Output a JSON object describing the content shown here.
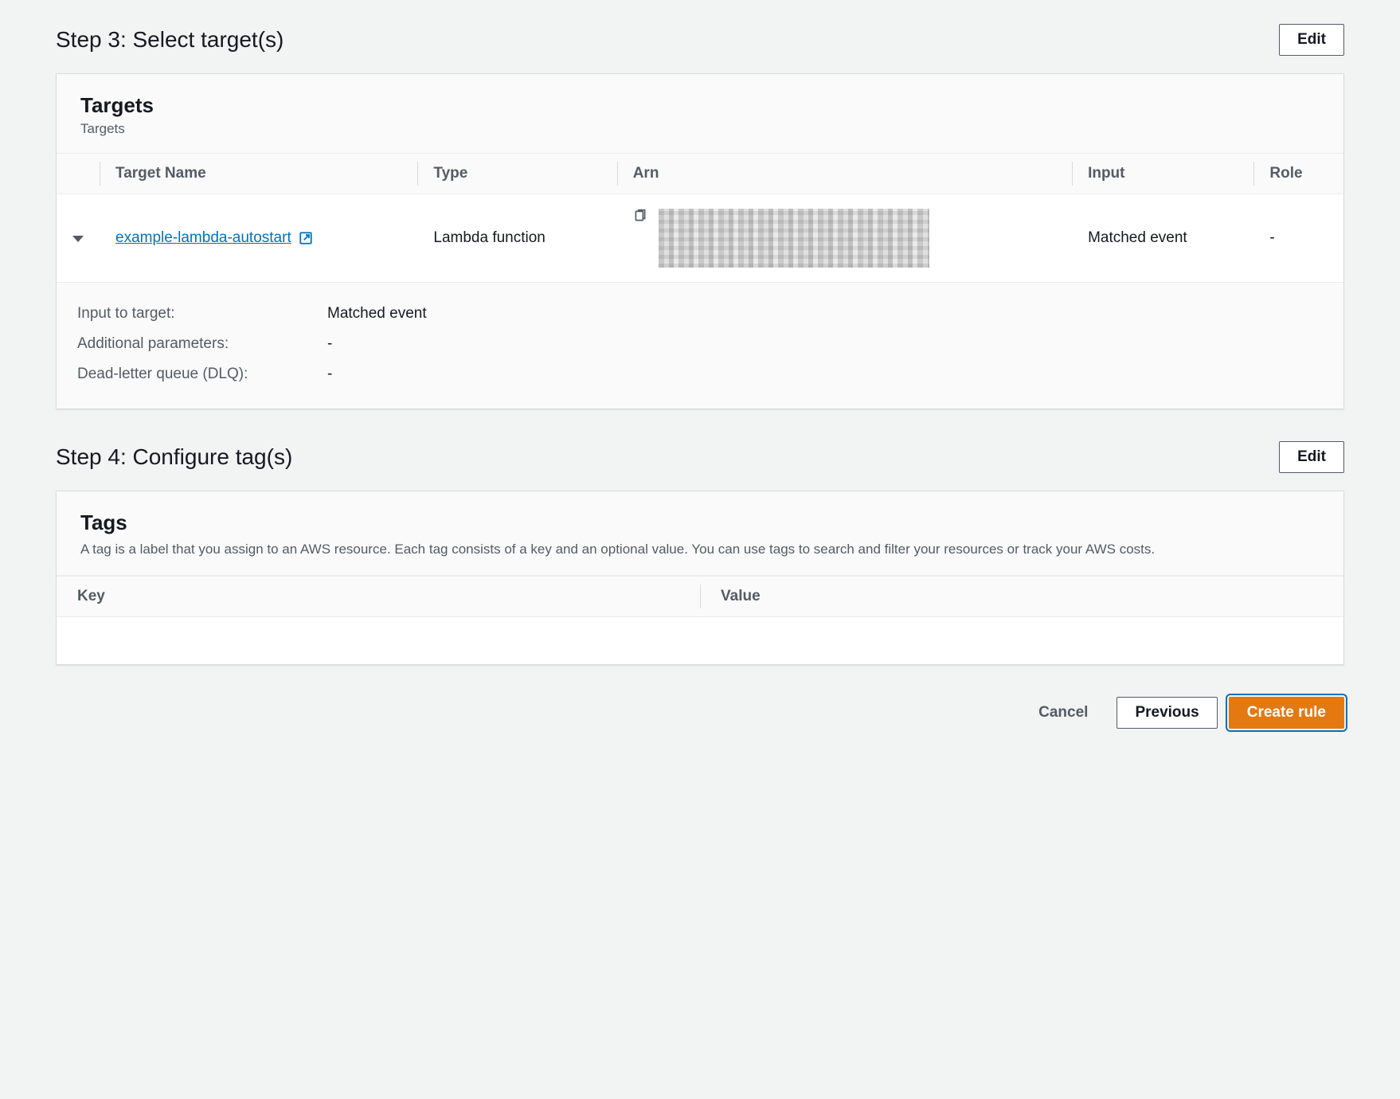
{
  "step3": {
    "title": "Step 3: Select target(s)",
    "edit_label": "Edit",
    "panel_title": "Targets",
    "panel_sub": "Targets",
    "columns": {
      "target_name": "Target Name",
      "type": "Type",
      "arn": "Arn",
      "input": "Input",
      "role": "Role"
    },
    "row": {
      "target_name": "example-lambda-autostart",
      "type": "Lambda function",
      "input": "Matched event",
      "role": "-"
    },
    "details": {
      "input_to_target_label": "Input to target:",
      "input_to_target_value": "Matched event",
      "additional_params_label": "Additional parameters:",
      "additional_params_value": "-",
      "dlq_label": "Dead-letter queue (DLQ):",
      "dlq_value": "-"
    }
  },
  "step4": {
    "title": "Step 4: Configure tag(s)",
    "edit_label": "Edit",
    "panel_title": "Tags",
    "panel_desc": "A tag is a label that you assign to an AWS resource. Each tag consists of a key and an optional value. You can use tags to search and filter your resources or track your AWS costs.",
    "columns": {
      "key": "Key",
      "value": "Value"
    }
  },
  "footer": {
    "cancel": "Cancel",
    "previous": "Previous",
    "create": "Create rule"
  }
}
